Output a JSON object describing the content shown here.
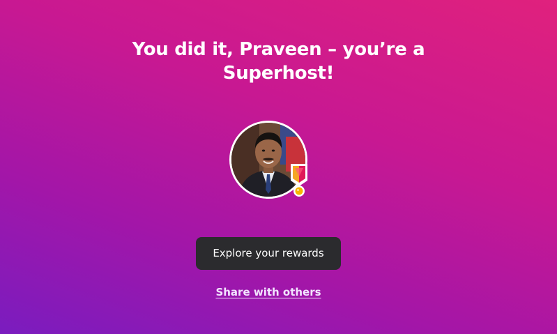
{
  "headline": {
    "line1": "You did it, Praveen – you’re a",
    "line2": "Superhost!"
  },
  "profile": {
    "avatar_icon": "user-photo",
    "badge_icon": "superhost-medal-icon",
    "badge_colors": {
      "ribbon_left": "#f5a623",
      "ribbon_right": "#e0195a",
      "medal": "#f7b500"
    }
  },
  "actions": {
    "primary_label": "Explore your rewards",
    "secondary_label": "Share with others"
  },
  "theme": {
    "gradient_top": "#e0217d",
    "gradient_bottom": "#7a1cbf",
    "button_bg": "#2b2b2e"
  }
}
